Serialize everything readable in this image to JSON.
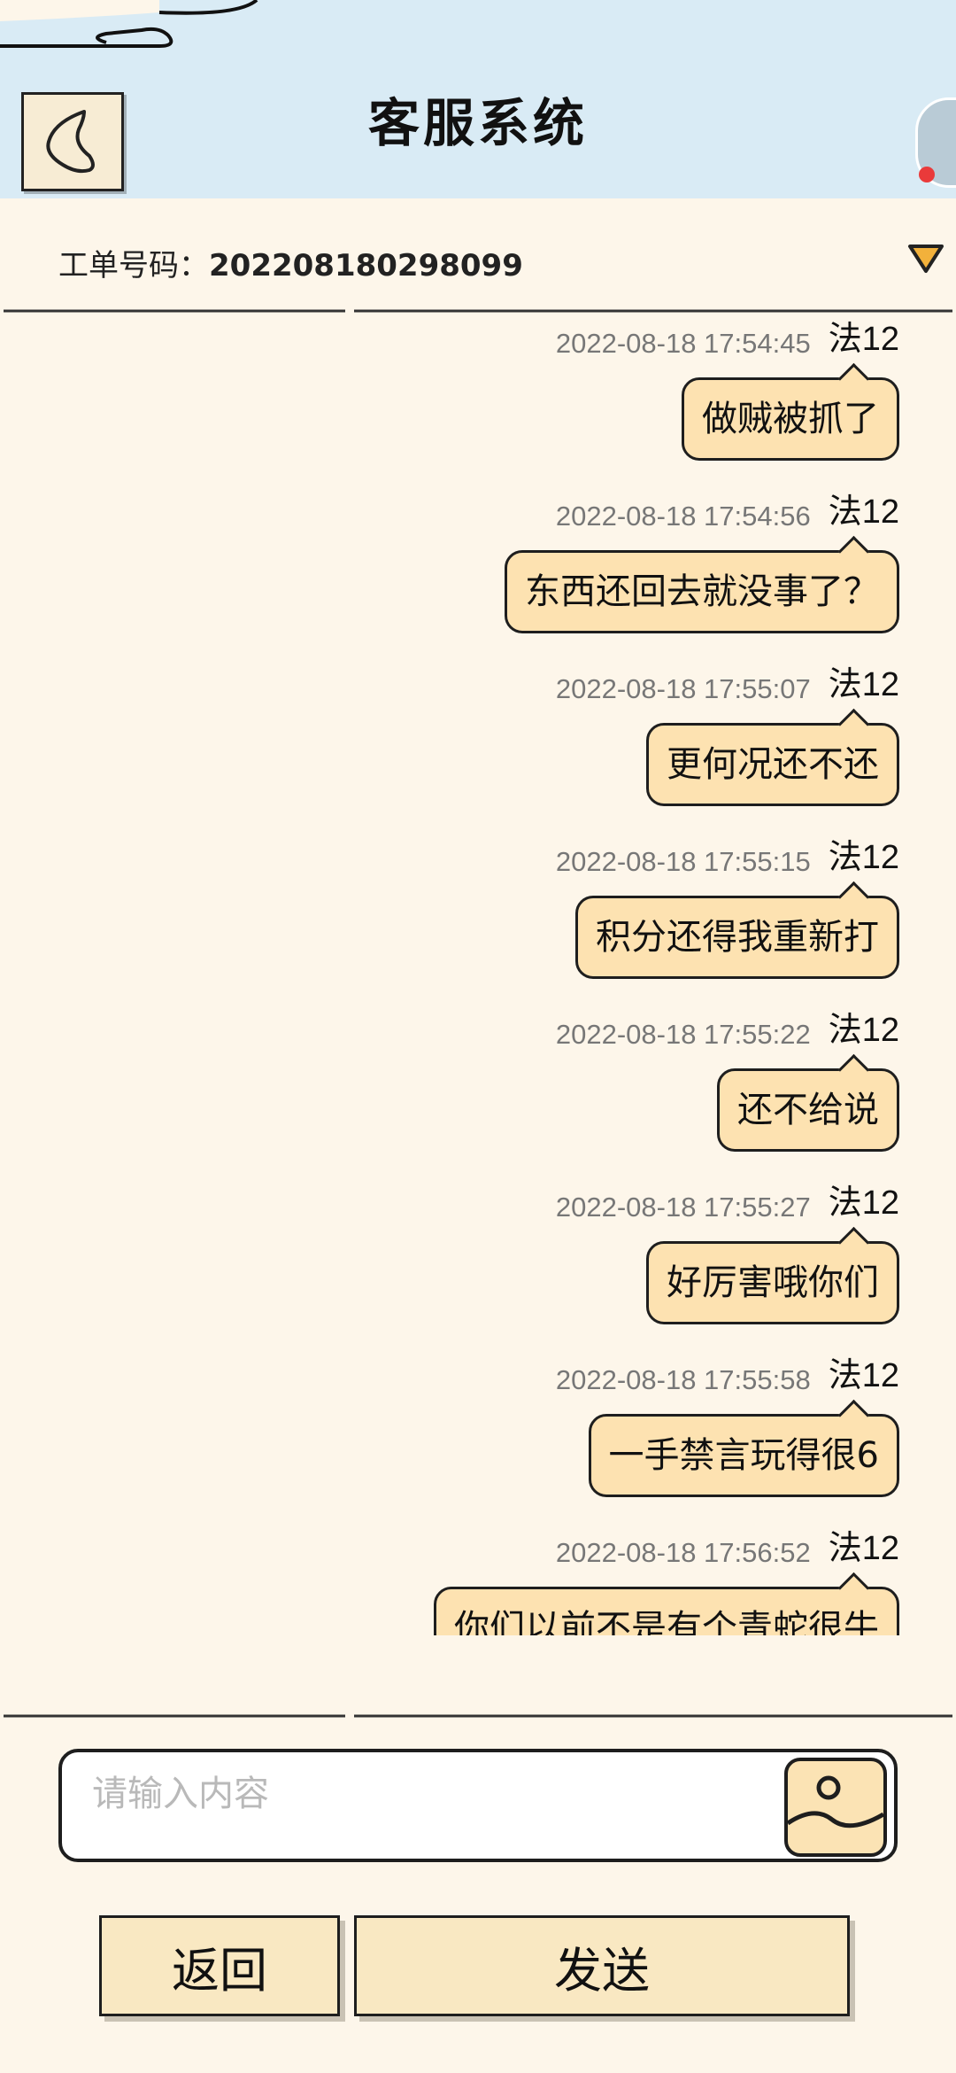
{
  "header": {
    "title": "客服系统"
  },
  "ticket": {
    "label": "工单号码：",
    "number": "202208180298099"
  },
  "messages": [
    {
      "time": "2022-08-18 17:54:45",
      "sender": "法12",
      "text": "做贼被抓了"
    },
    {
      "time": "2022-08-18 17:54:56",
      "sender": "法12",
      "text": "东西还回去就没事了？"
    },
    {
      "time": "2022-08-18 17:55:07",
      "sender": "法12",
      "text": "更何况还不还"
    },
    {
      "time": "2022-08-18 17:55:15",
      "sender": "法12",
      "text": "积分还得我重新打"
    },
    {
      "time": "2022-08-18 17:55:22",
      "sender": "法12",
      "text": "还不给说"
    },
    {
      "time": "2022-08-18 17:55:27",
      "sender": "法12",
      "text": "好厉害哦你们"
    },
    {
      "time": "2022-08-18 17:55:58",
      "sender": "法12",
      "text": "一手禁言玩得很6"
    },
    {
      "time": "2022-08-18 17:56:52",
      "sender": "法12",
      "text": "你们以前不是有个青蛇很牛"
    }
  ],
  "input": {
    "placeholder": "请输入内容"
  },
  "buttons": {
    "back": "返回",
    "send": "发送"
  },
  "colors": {
    "header_bg": "#d9ebf5",
    "page_bg": "#fdf6ea",
    "bubble_bg": "#fde2b1",
    "button_bg": "#f9e8c2",
    "dropdown_fill": "#f2b13b",
    "notification_dot": "#ea3a3a"
  },
  "icons": {
    "back": "back-chevron-icon",
    "dropdown": "triangle-down-icon",
    "image": "image-icon"
  }
}
